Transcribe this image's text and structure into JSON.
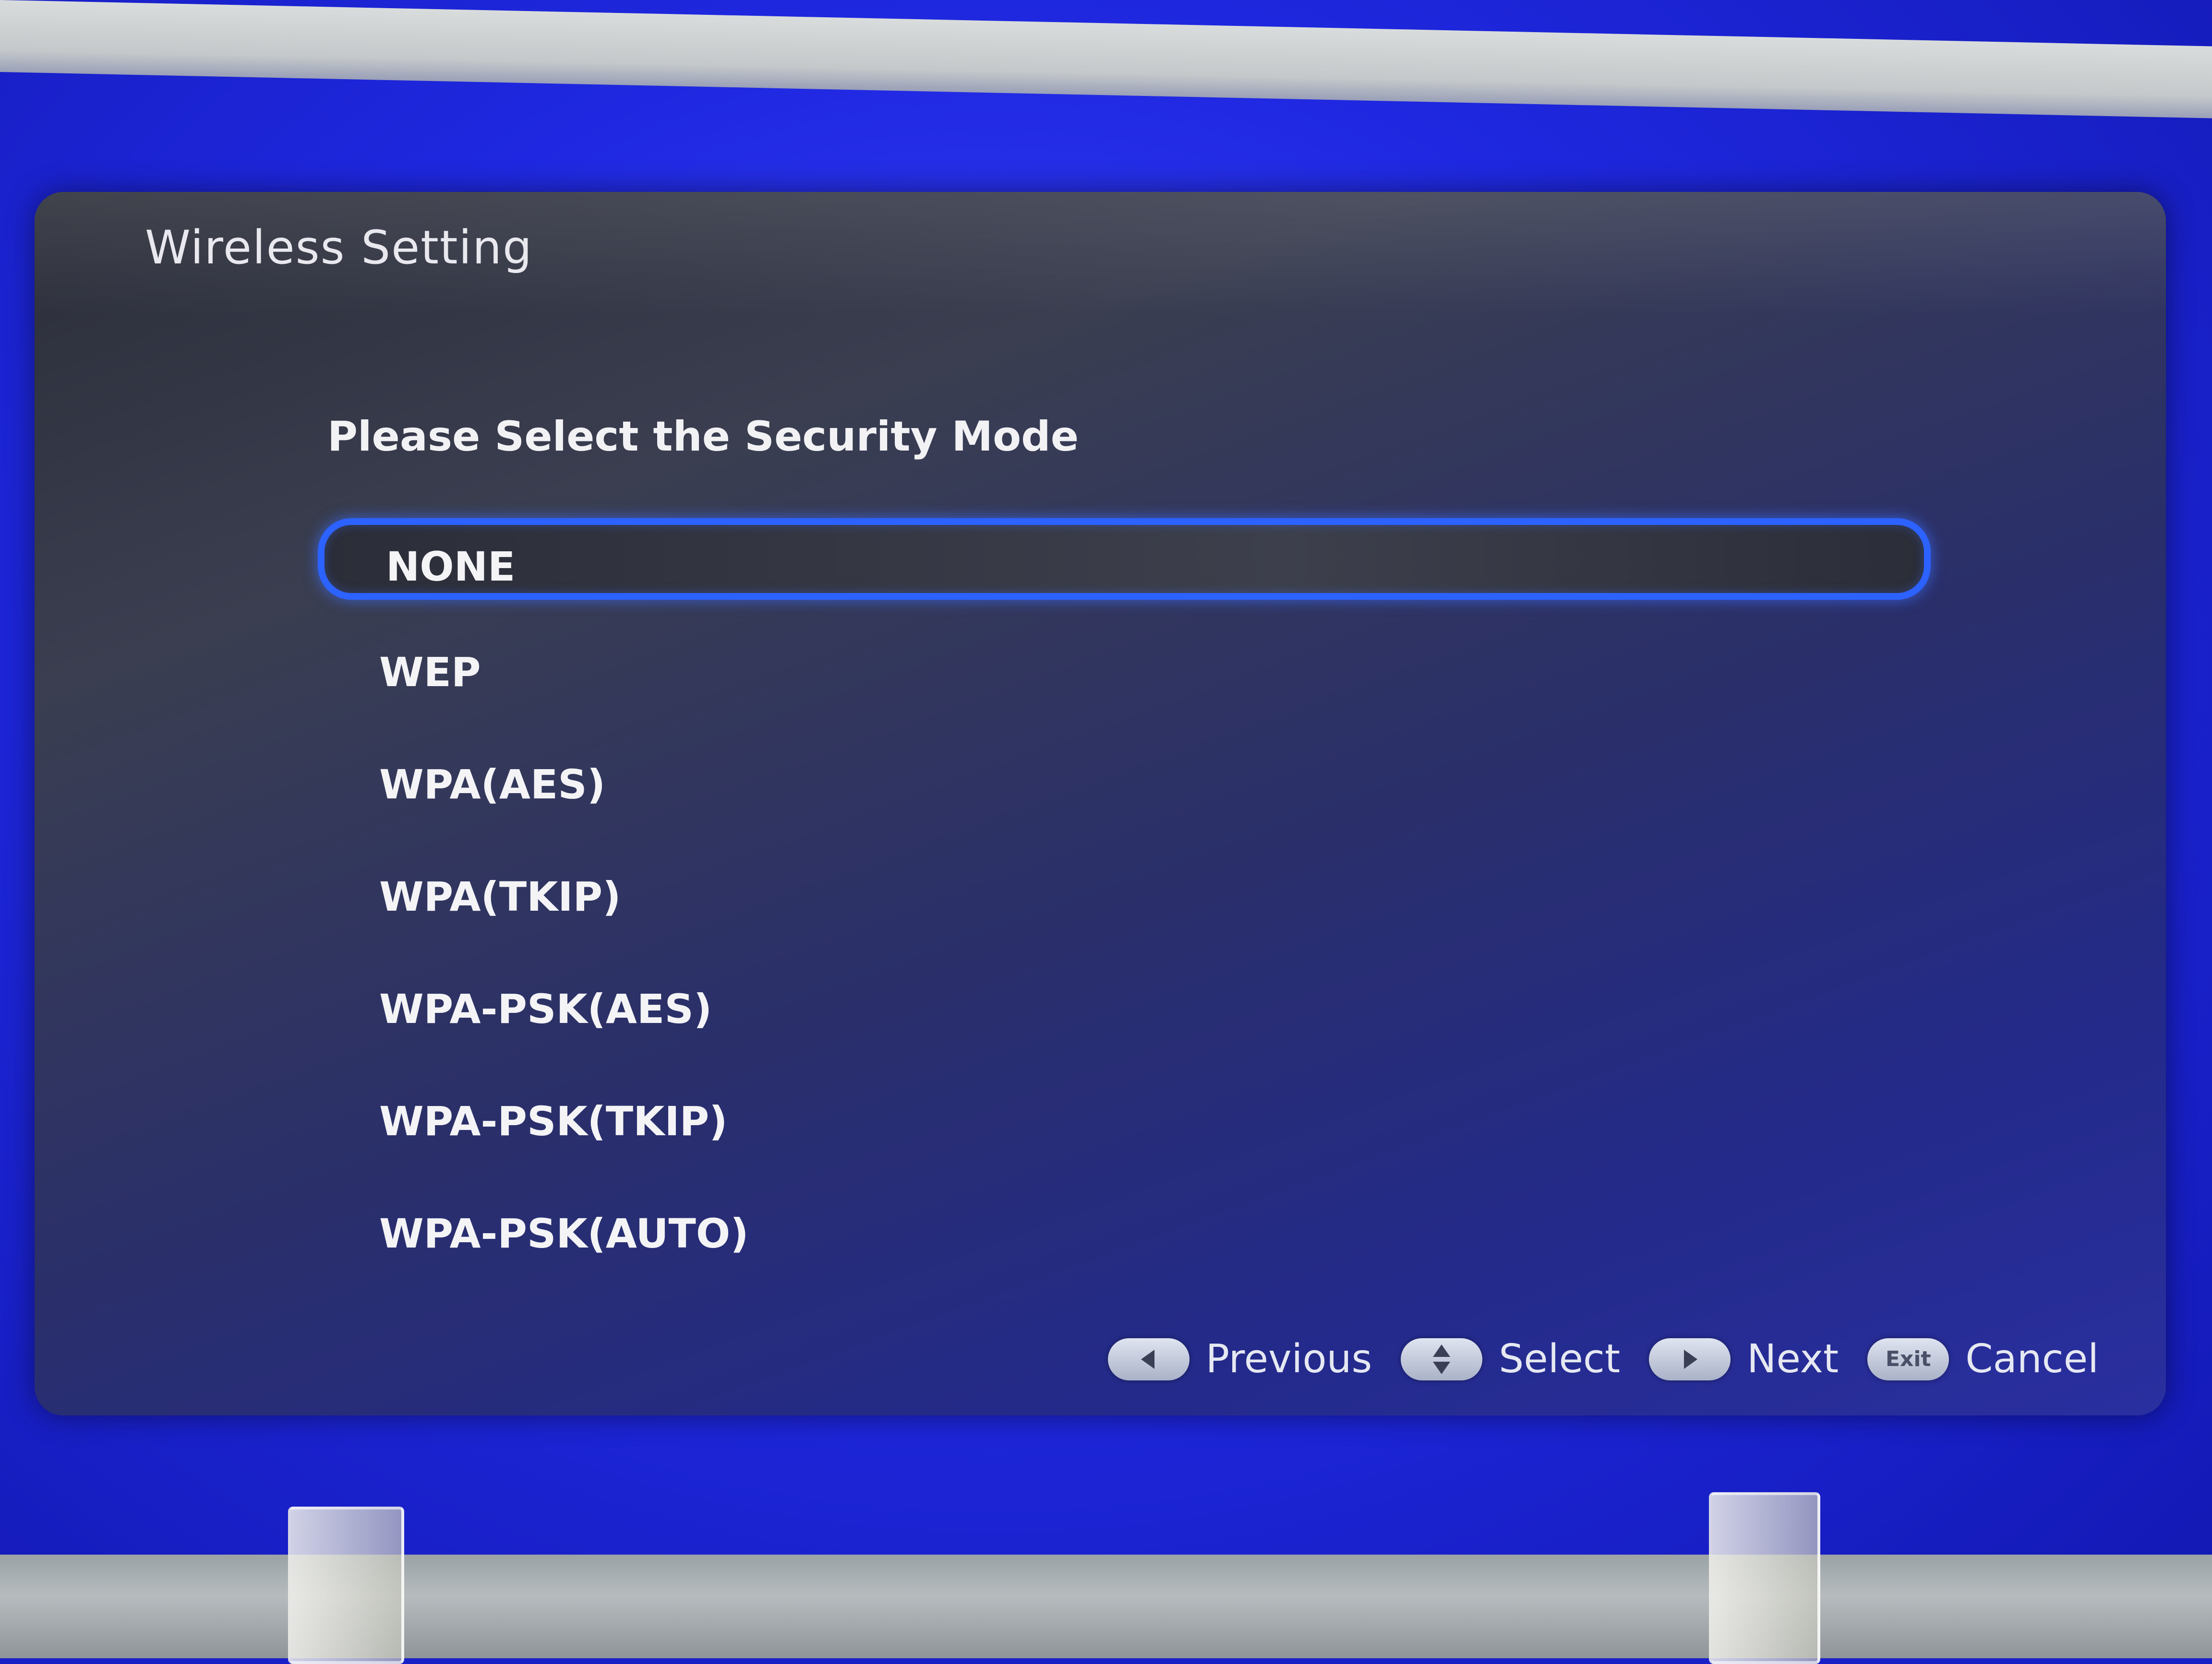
{
  "dialog": {
    "title": "Wireless Setting",
    "prompt": "Please Select the Security Mode"
  },
  "options": [
    {
      "label": "NONE",
      "selected": true
    },
    {
      "label": "WEP",
      "selected": false
    },
    {
      "label": "WPA(AES)",
      "selected": false
    },
    {
      "label": "WPA(TKIP)",
      "selected": false
    },
    {
      "label": "WPA-PSK(AES)",
      "selected": false
    },
    {
      "label": "WPA-PSK(TKIP)",
      "selected": false
    },
    {
      "label": "WPA-PSK(AUTO)",
      "selected": false
    }
  ],
  "hints": {
    "previous": {
      "icon": "arrow-left-icon",
      "label": "Previous"
    },
    "select": {
      "icon": "arrow-up-down-icon",
      "label": "Select"
    },
    "next": {
      "icon": "arrow-right-icon",
      "label": "Next"
    },
    "cancel": {
      "icon": "exit-key-icon",
      "key_text": "Exit",
      "label": "Cancel"
    }
  },
  "colors": {
    "screen_blue": "#1f28e0",
    "selection_border": "#2c62ff",
    "text": "#f4f4f6"
  }
}
